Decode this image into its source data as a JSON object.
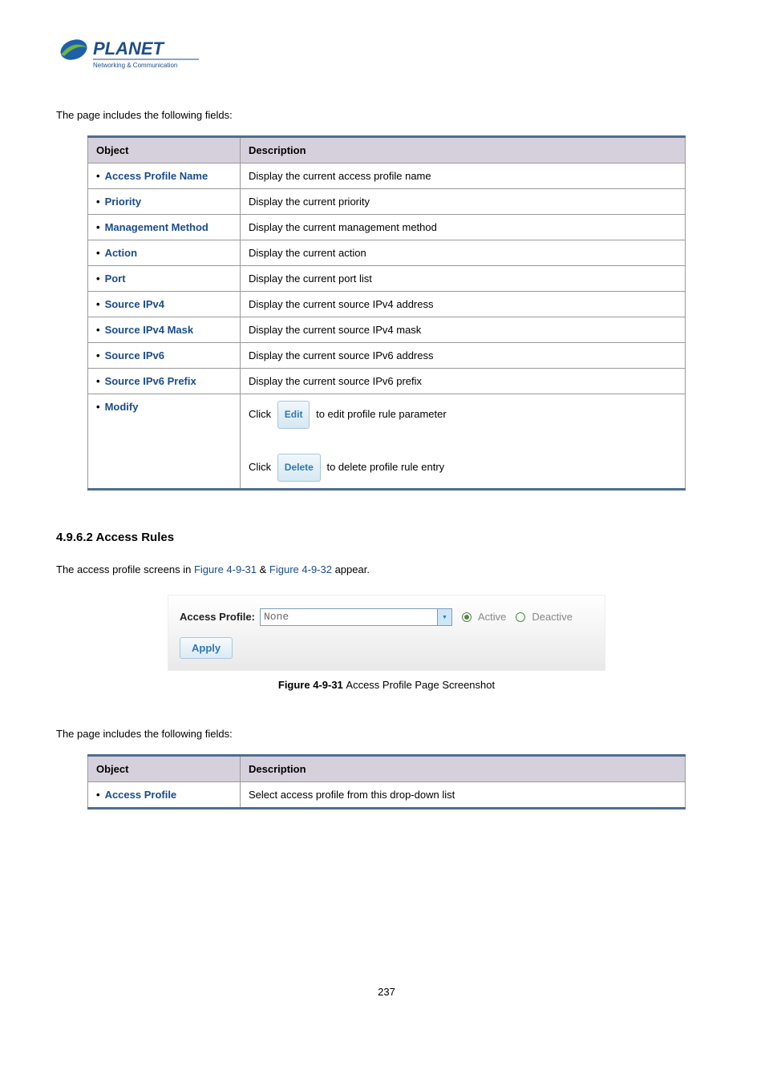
{
  "logo": {
    "brand": "PLANET",
    "tagline": "Networking & Communication"
  },
  "intro1": "The page includes the following fields:",
  "table1": {
    "head_obj": "Object",
    "head_desc": "Description",
    "rows": [
      {
        "obj": "Access Profile Name",
        "desc": "Display the current access profile name"
      },
      {
        "obj": "Priority",
        "desc": "Display the current priority"
      },
      {
        "obj": "Management Method",
        "desc": "Display the current management method"
      },
      {
        "obj": "Action",
        "desc": "Display the current action"
      },
      {
        "obj": "Port",
        "desc": "Display the current port list"
      },
      {
        "obj": "Source IPv4",
        "desc": "Display the current source IPv4 address"
      },
      {
        "obj": "Source IPv4 Mask",
        "desc": "Display the current source IPv4 mask"
      },
      {
        "obj": "Source IPv6",
        "desc": "Display the current source IPv6 address"
      },
      {
        "obj": "Source IPv6 Prefix",
        "desc": "Display the current source IPv6 prefix"
      }
    ],
    "modify": {
      "obj": "Modify",
      "click1_pre": "Click",
      "edit_btn": "Edit",
      "click1_post": "to edit profile rule parameter",
      "click2_pre": "Click",
      "delete_btn": "Delete",
      "click2_post": "to delete profile rule entry"
    }
  },
  "section_heading": "4.9.6.2 Access Rules",
  "body_sentence": {
    "pre": "The access profile screens in ",
    "link1": "Figure 4-9-31",
    "mid": " & ",
    "link2": "Figure 4-9-32",
    "post": " appear."
  },
  "screenshot": {
    "label": "Access Profile:",
    "select_value": "None",
    "radio_active": "Active",
    "radio_deactive": "Deactive",
    "apply": "Apply"
  },
  "figure_caption": {
    "bold": "Figure 4-9-31 ",
    "rest": "Access Profile Page Screenshot"
  },
  "intro2": "The page includes the following fields:",
  "table2": {
    "head_obj": "Object",
    "head_desc": "Description",
    "rows": [
      {
        "obj": "Access Profile",
        "desc": "Select access profile from this drop-down list"
      }
    ]
  },
  "page_number": "237"
}
